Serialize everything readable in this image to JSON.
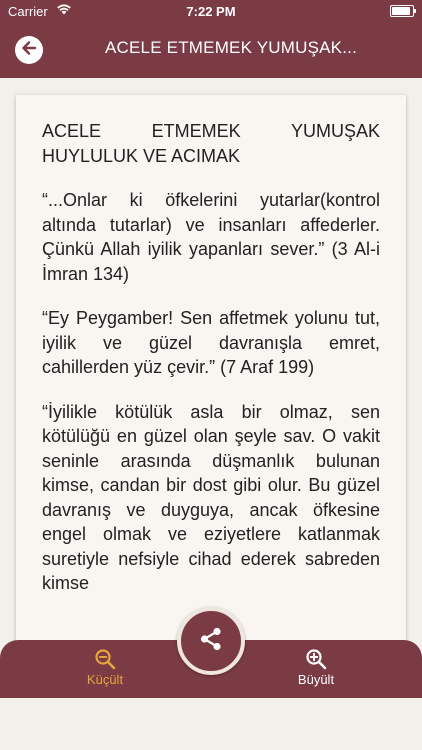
{
  "status_bar": {
    "carrier": "Carrier",
    "time": "7:22 PM"
  },
  "header": {
    "title": "ACELE ETMEMEK YUMUŞAK..."
  },
  "content": {
    "paragraphs": [
      "ACELE ETMEMEK YUMUŞAK HUYLULUK VE ACIMAK",
      "“...Onlar ki öfkelerini yutarlar(kontrol altında tutarlar) ve insanları affederler. Çünkü Allah iyilik yapanları sever.” (3 Al-i İmran 134)",
      "“Ey Peygamber! Sen affetmek yolunu tut, iyilik ve güzel davranışla emret, cahillerden yüz çevir.” (7 Araf 199)",
      "“İyilikle kötülük asla bir olmaz, sen kötülüğü en güzel olan şeyle sav. O vakit seninle arasında düşmanlık bulunan kimse, candan bir dost gibi olur. Bu güzel davranış ve duyguya, ancak öfkesine engel olmak ve eziyetlere katlanmak suretiyle nefsiyle cihad ederek sabreden kimse"
    ]
  },
  "bottom_bar": {
    "shrink_label": "Küçült",
    "grow_label": "Büyült"
  },
  "colors": {
    "primary": "#7a3b45",
    "accent": "#e6a53a",
    "background": "#f3f0ec"
  },
  "icons": {
    "back": "arrow-left-icon",
    "shrink": "zoom-out-icon",
    "grow": "zoom-in-icon",
    "share": "share-icon",
    "wifi": "wifi-icon",
    "battery": "battery-icon"
  }
}
